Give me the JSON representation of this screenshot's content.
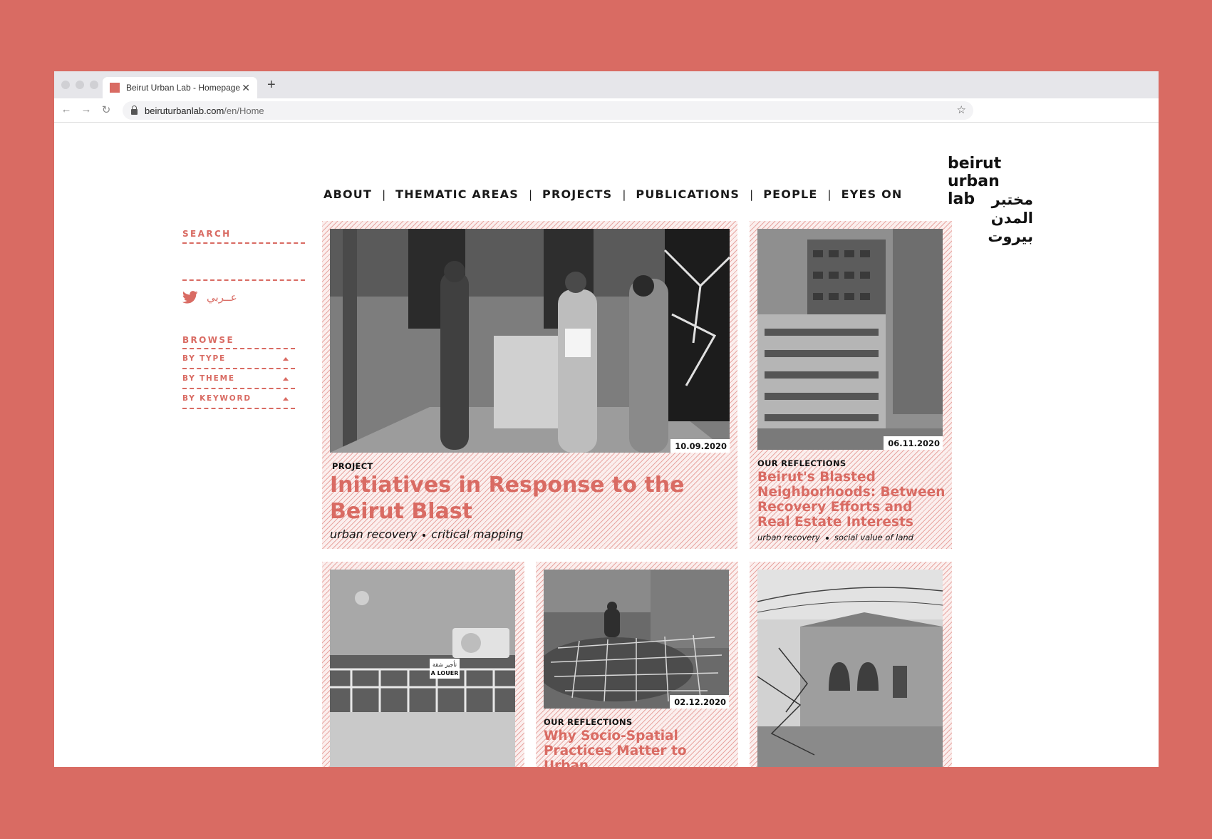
{
  "browser": {
    "tab_title": "Beirut Urban Lab - Homepage",
    "url_domain": "beiruturbanlab.com",
    "url_path": "/en/Home"
  },
  "logo": {
    "english": "beirut\nurban\nlab",
    "arabic": "مختبر\nالمدن\nبيروت"
  },
  "nav": [
    "ABOUT",
    "THEMATIC AREAS",
    "PROJECTS",
    "PUBLICATIONS",
    "PEOPLE",
    "EYES ON"
  ],
  "sidebar": {
    "search_label": "SEARCH",
    "language_link": "عــربي",
    "browse_label": "BROWSE",
    "filters": [
      "BY TYPE",
      "BY THEME",
      "BY KEYWORD"
    ]
  },
  "cards": [
    {
      "type": "PROJECT",
      "title": "Initiatives in Response to the Beirut Blast",
      "date": "10.09.2020",
      "tags": [
        "urban recovery",
        "critical mapping"
      ]
    },
    {
      "type": "OUR REFLECTIONS",
      "title": "Beirut's Blasted Neighborhoods: Between Recovery Efforts and Real Estate Interests",
      "date": "06.11.2020",
      "tags": [
        "urban recovery",
        "social value of land"
      ]
    },
    {
      "sign_line1": "تأجير شقة",
      "sign_line2": "A LOUER"
    },
    {
      "type": "OUR REFLECTIONS",
      "title": "Why Socio-Spatial Practices Matter to Urban",
      "date": "02.12.2020"
    },
    {}
  ],
  "colors": {
    "accent": "#d96b63",
    "text": "#1a1a1a",
    "background": "#ffffff"
  }
}
